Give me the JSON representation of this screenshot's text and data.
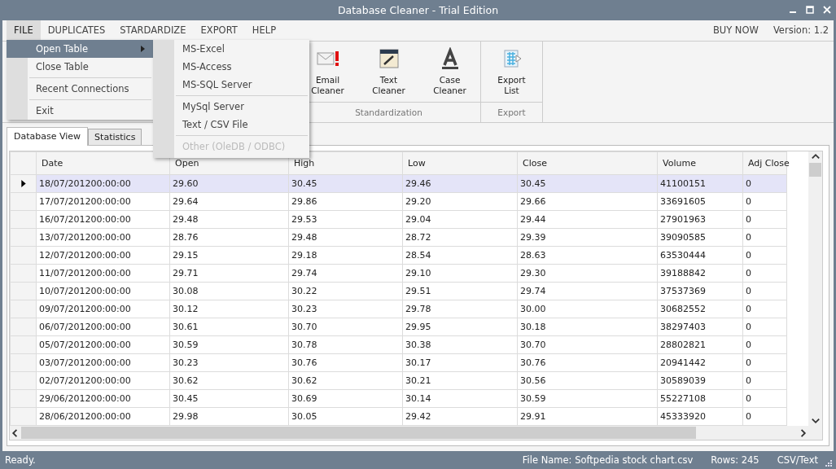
{
  "window": {
    "title": "Database Cleaner - Trial Edition"
  },
  "menu": [
    {
      "label": "FILE",
      "selected": true
    },
    {
      "label": "DUPLICATES",
      "selected": false
    },
    {
      "label": "STARDARDIZE",
      "selected": false
    },
    {
      "label": "EXPORT",
      "selected": false
    },
    {
      "label": "HELP",
      "selected": false
    }
  ],
  "menu_right": {
    "buy_now": "BUY NOW",
    "version": "Version: 1.2"
  },
  "ribbon_groups": [
    {
      "label": "Standardization",
      "buttons": [
        {
          "label": "Email\nCleaner",
          "kind": "email"
        },
        {
          "label": "Text\nCleaner",
          "kind": "text"
        },
        {
          "label": "Case\nCleaner",
          "kind": "case"
        }
      ]
    },
    {
      "label": "Export",
      "buttons": [
        {
          "label": "Export\nList",
          "kind": "export"
        }
      ]
    }
  ],
  "file_menu": [
    {
      "kind": "item",
      "label": "Open Table",
      "selected": true,
      "submenu": true
    },
    {
      "kind": "item",
      "label": "Close Table",
      "selected": false,
      "submenu": false
    },
    {
      "kind": "separator"
    },
    {
      "kind": "item",
      "label": "Recent Connections",
      "selected": false,
      "submenu": false
    },
    {
      "kind": "separator"
    },
    {
      "kind": "item",
      "label": "Exit",
      "selected": false,
      "submenu": false
    }
  ],
  "open_table_submenu": [
    {
      "kind": "item",
      "label": "MS-Excel",
      "disabled": false
    },
    {
      "kind": "item",
      "label": "MS-Access",
      "disabled": false
    },
    {
      "kind": "item",
      "label": "MS-SQL Server",
      "disabled": false
    },
    {
      "kind": "separator"
    },
    {
      "kind": "item",
      "label": "MySql Server",
      "disabled": false
    },
    {
      "kind": "item",
      "label": "Text / CSV File",
      "disabled": false
    },
    {
      "kind": "separator"
    },
    {
      "kind": "item",
      "label": "Other (OleDB / ODBC)",
      "disabled": true
    }
  ],
  "tabs": [
    {
      "label": "Database View",
      "selected": true
    },
    {
      "label": "Statistics",
      "selected": false
    }
  ],
  "table": {
    "columns": [
      "Date",
      "Open",
      "High",
      "Low",
      "Close",
      "Volume",
      "Adj Close"
    ],
    "rows": [
      {
        "selected": true,
        "cells": [
          "18/07/201200:00:00",
          "29.60",
          "30.45",
          "29.46",
          "30.45",
          "41100151",
          "0"
        ]
      },
      {
        "selected": false,
        "cells": [
          "17/07/201200:00:00",
          "29.64",
          "29.86",
          "29.20",
          "29.66",
          "33691605",
          "0"
        ]
      },
      {
        "selected": false,
        "cells": [
          "16/07/201200:00:00",
          "29.48",
          "29.53",
          "29.04",
          "29.44",
          "27901963",
          "0"
        ]
      },
      {
        "selected": false,
        "cells": [
          "13/07/201200:00:00",
          "28.76",
          "29.48",
          "28.72",
          "29.39",
          "39090585",
          "0"
        ]
      },
      {
        "selected": false,
        "cells": [
          "12/07/201200:00:00",
          "29.15",
          "29.18",
          "28.54",
          "28.63",
          "63530444",
          "0"
        ]
      },
      {
        "selected": false,
        "cells": [
          "11/07/201200:00:00",
          "29.71",
          "29.74",
          "29.10",
          "29.30",
          "39188842",
          "0"
        ]
      },
      {
        "selected": false,
        "cells": [
          "10/07/201200:00:00",
          "30.08",
          "30.22",
          "29.51",
          "29.74",
          "37537369",
          "0"
        ]
      },
      {
        "selected": false,
        "cells": [
          "09/07/201200:00:00",
          "30.12",
          "30.23",
          "29.78",
          "30.00",
          "30682552",
          "0"
        ]
      },
      {
        "selected": false,
        "cells": [
          "06/07/201200:00:00",
          "30.61",
          "30.70",
          "29.95",
          "30.18",
          "38297403",
          "0"
        ]
      },
      {
        "selected": false,
        "cells": [
          "05/07/201200:00:00",
          "30.59",
          "30.78",
          "30.38",
          "30.70",
          "28802821",
          "0"
        ]
      },
      {
        "selected": false,
        "cells": [
          "03/07/201200:00:00",
          "30.23",
          "30.76",
          "30.17",
          "30.76",
          "20941442",
          "0"
        ]
      },
      {
        "selected": false,
        "cells": [
          "02/07/201200:00:00",
          "30.62",
          "30.62",
          "30.21",
          "30.56",
          "30589039",
          "0"
        ]
      },
      {
        "selected": false,
        "cells": [
          "29/06/201200:00:00",
          "30.45",
          "30.69",
          "30.14",
          "30.59",
          "55227108",
          "0"
        ]
      },
      {
        "selected": false,
        "cells": [
          "28/06/201200:00:00",
          "29.98",
          "30.05",
          "29.42",
          "29.91",
          "45333920",
          "0"
        ]
      }
    ]
  },
  "status_bar": {
    "message": "Ready.",
    "file_name": "File Name: Softpedia stock chart.csv",
    "rows": "Rows: 245",
    "format": "CSV/Text"
  }
}
